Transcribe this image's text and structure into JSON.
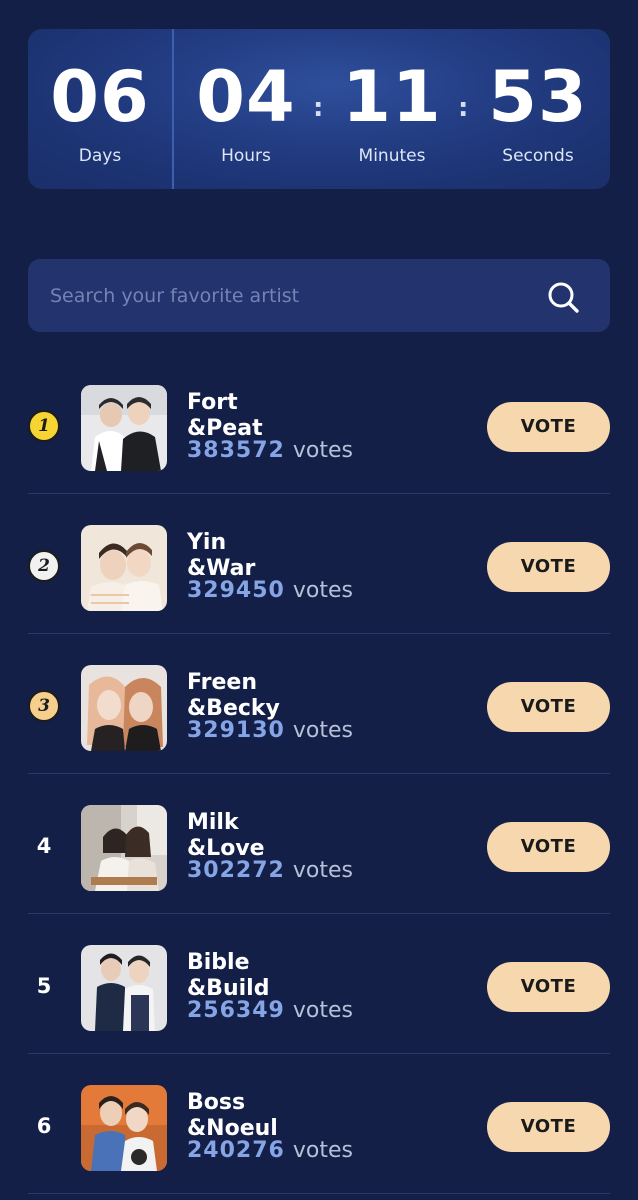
{
  "countdown": {
    "days": {
      "value": "06",
      "label": "Days"
    },
    "hours": {
      "value": "04",
      "label": "Hours"
    },
    "minutes": {
      "value": "11",
      "label": "Minutes"
    },
    "seconds": {
      "value": "53",
      "label": "Seconds"
    },
    "separator": ":"
  },
  "search": {
    "placeholder": "Search your favorite artist",
    "icon": "search-icon"
  },
  "vote_word": "votes",
  "vote_button_label": "VOTE",
  "ranking": [
    {
      "rank": "1",
      "badge": "gold",
      "name_line1": "Fort",
      "name_line2": "&Peat",
      "votes": "383572"
    },
    {
      "rank": "2",
      "badge": "silver",
      "name_line1": "Yin",
      "name_line2": "&War",
      "votes": "329450"
    },
    {
      "rank": "3",
      "badge": "bronze",
      "name_line1": "Freen",
      "name_line2": "&Becky",
      "votes": "329130"
    },
    {
      "rank": "4",
      "badge": "none",
      "name_line1": "Milk",
      "name_line2": "&Love",
      "votes": "302272"
    },
    {
      "rank": "5",
      "badge": "none",
      "name_line1": "Bible",
      "name_line2": "&Build",
      "votes": "256349"
    },
    {
      "rank": "6",
      "badge": "none",
      "name_line1": "Boss",
      "name_line2": "&Noeul",
      "votes": "240276"
    }
  ],
  "colors": {
    "background": "#131f47",
    "accent_votes": "#86a5e6",
    "vote_button": "#f6d7ae",
    "gold": "#f6d532",
    "silver": "#f1f1f1",
    "bronze": "#f6cf8c"
  }
}
